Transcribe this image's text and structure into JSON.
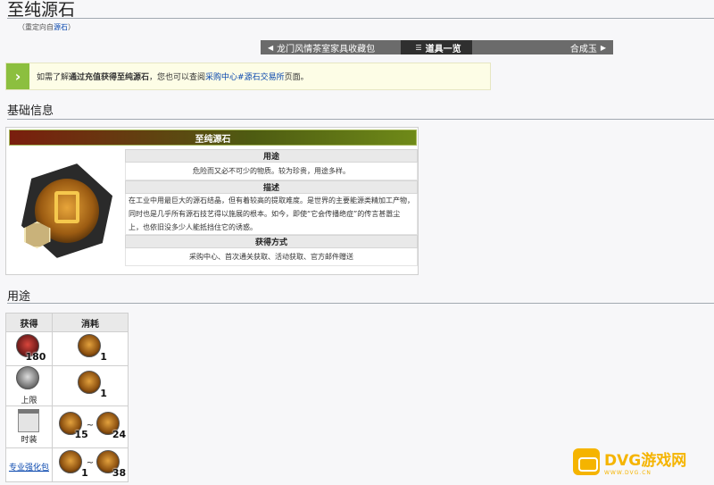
{
  "page": {
    "title": "至纯源石",
    "redirect_prefix": "（重定向自",
    "redirect_link": "源石",
    "redirect_suffix": "）"
  },
  "nav": {
    "prev": "龙门风情茶室家具收藏包",
    "current": "道具一览",
    "next": "合成玉"
  },
  "notice": {
    "prefix": "如需了解",
    "bold": "通过充值获得至纯源石",
    "middle": "，您也可以查阅",
    "link": "采购中心#源石交易所",
    "suffix": "页面。"
  },
  "sections": {
    "basic": "基础信息",
    "usage": "用途"
  },
  "infobox": {
    "name": "至纯源石",
    "rows": [
      {
        "header": "用途",
        "value": "危险而又必不可少的物质。较为珍贵，用途多样。"
      },
      {
        "header": "描述",
        "value": "在工业中用最巨大的源石结晶，但有着较高的提取难度。是世界的主要能源类精加工产物，同时也是几乎所有源石技艺得以施展的根本。如今，即使“它会传播绝症”的传言甚嚣尘上，也依旧没多少人能抵挡住它的诱惑。"
      },
      {
        "header": "获得方式",
        "value": "采购中心、首次通关获取、活动获取、官方邮件赠送"
      }
    ]
  },
  "usage_table": {
    "headers": [
      "获得",
      "消耗"
    ],
    "rows": [
      {
        "get_qty": "180",
        "get_icon": "potion-icon",
        "get_label": "",
        "cost": [
          "1"
        ]
      },
      {
        "get_qty": "",
        "get_icon": "clock-icon",
        "get_label": "上限",
        "cost": [
          "1"
        ]
      },
      {
        "get_qty": "",
        "get_icon": "calendar-icon",
        "get_label": "时装",
        "cost": [
          "15",
          "24"
        ]
      },
      {
        "get_qty": "",
        "get_icon": "",
        "get_label": "专业强化包",
        "cost": [
          "1",
          "38"
        ]
      }
    ],
    "range_sep": "~"
  },
  "watermark": {
    "text": "DVG游戏网",
    "sub": "WWW.DVG.CN"
  }
}
